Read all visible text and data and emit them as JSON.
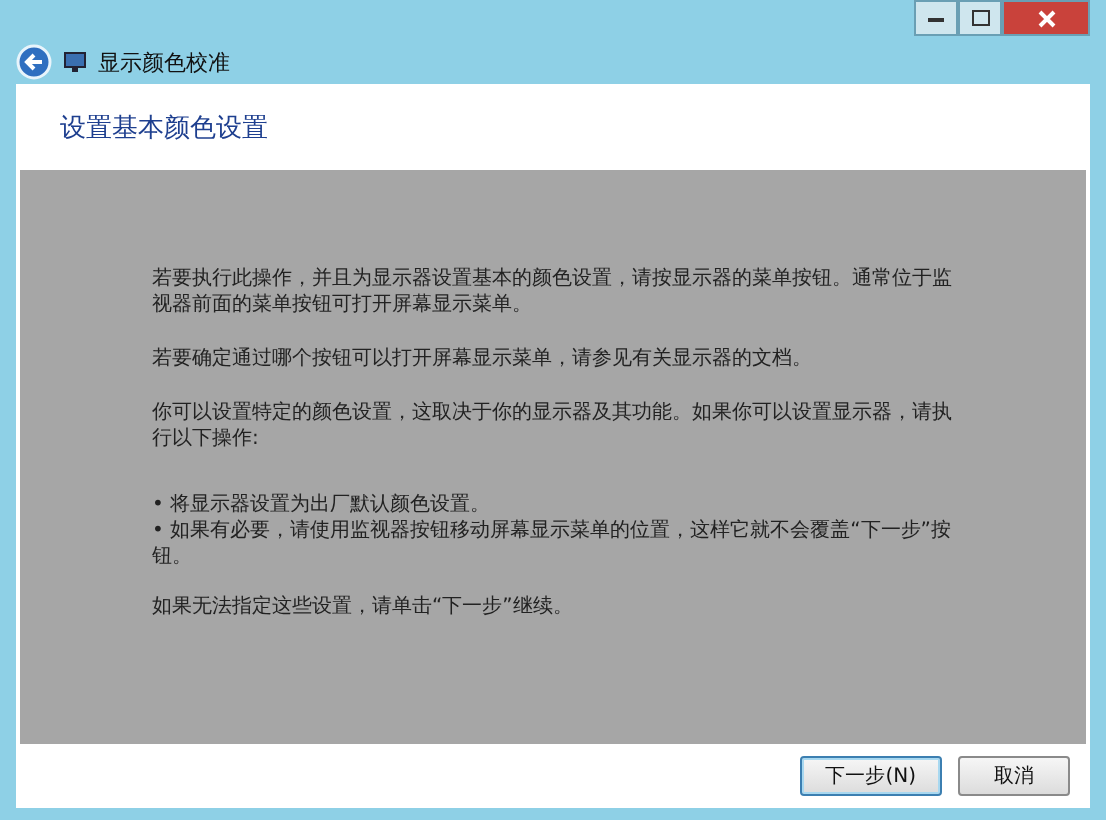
{
  "window": {
    "title": "显示颜色校准"
  },
  "heading": "设置基本颜色设置",
  "paragraphs": [
    "若要执行此操作，并且为显示器设置基本的颜色设置，请按显示器的菜单按钮。通常位于监视器前面的菜单按钮可打开屏幕显示菜单。",
    "若要确定通过哪个按钮可以打开屏幕显示菜单，请参见有关显示器的文档。",
    "你可以设置特定的颜色设置，这取决于你的显示器及其功能。如果你可以设置显示器，请执行以下操作:"
  ],
  "bullets": [
    "• 将显示器设置为出厂默认颜色设置。",
    "• 如果有必要，请使用监视器按钮移动屏幕显示菜单的位置，这样它就不会覆盖“下一步”按钮。"
  ],
  "closing": "如果无法指定这些设置，请单击“下一步”继续。",
  "buttons": [
    {
      "label": "下一步(N)",
      "default": true
    },
    {
      "label": "取消",
      "default": false
    }
  ]
}
